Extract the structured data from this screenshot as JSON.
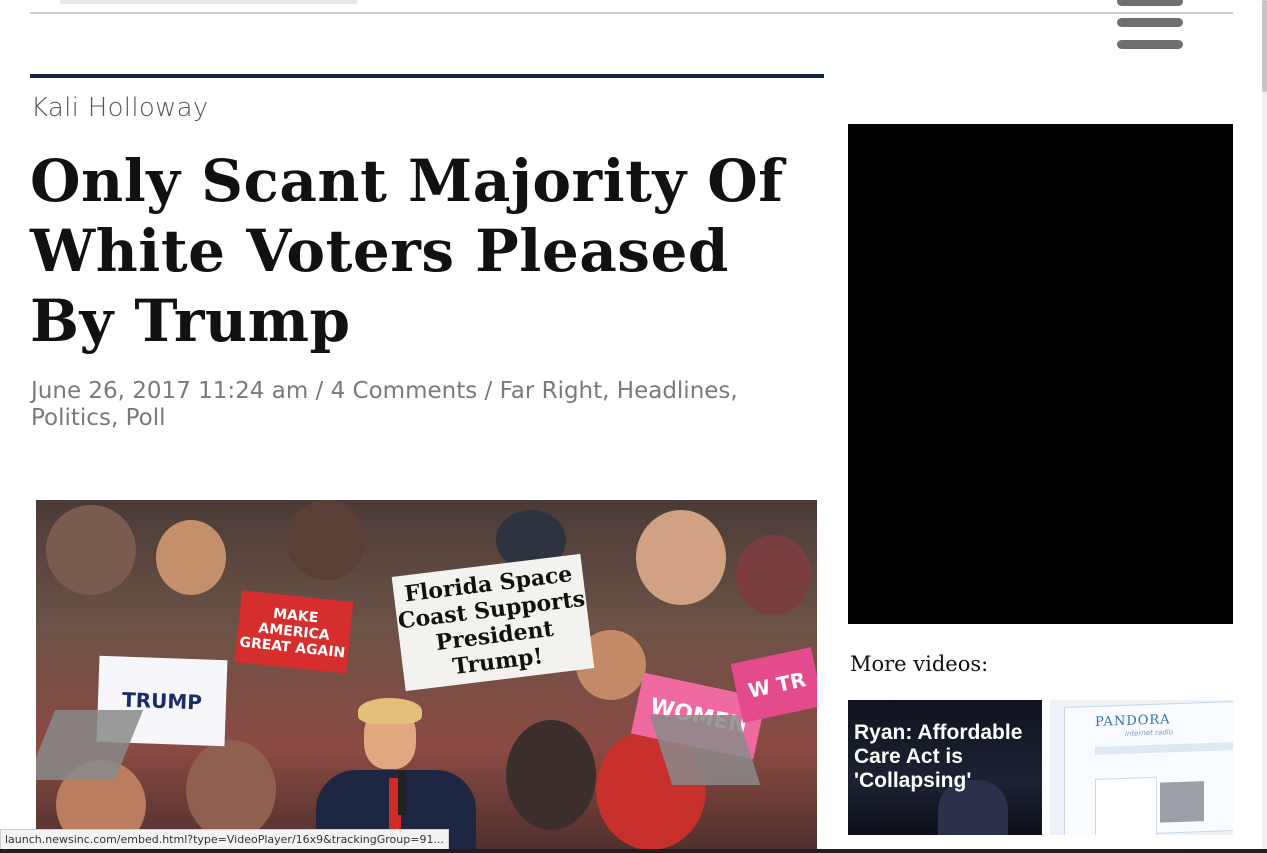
{
  "header": {
    "menu_icon": "hamburger-menu-icon"
  },
  "article": {
    "author": "Kali Holloway",
    "headline": "Only Scant Majority Of White Voters Pleased By Trump",
    "date": "June 26, 2017 11:24 am",
    "separator": " / ",
    "comments": "4 Comments",
    "categories": [
      "Far Right",
      "Headlines",
      "Politics",
      "Poll"
    ],
    "image": {
      "sign_florida": "Florida Space Coast Supports President Trump!",
      "sign_trump": "TRUMP",
      "sign_maga": "MAKE AMERICA GREAT AGAIN",
      "sign_women": "WOMEN",
      "sign_pink": "W TR"
    }
  },
  "sidebar": {
    "more_videos_label": "More videos:",
    "videos": [
      {
        "title": "Ryan: Affordable Care Act is 'Collapsing'"
      },
      {
        "brand": "PANDORA",
        "tagline": "internet radio"
      }
    ]
  },
  "status_bar": {
    "url": "launch.newsinc.com/embed.html?type=VideoPlayer/16x9&trackingGroup=91..."
  },
  "colors": {
    "accent_rule": "#16264a",
    "meta_text": "#7a7a7a",
    "video_player_bg": "#000000"
  }
}
